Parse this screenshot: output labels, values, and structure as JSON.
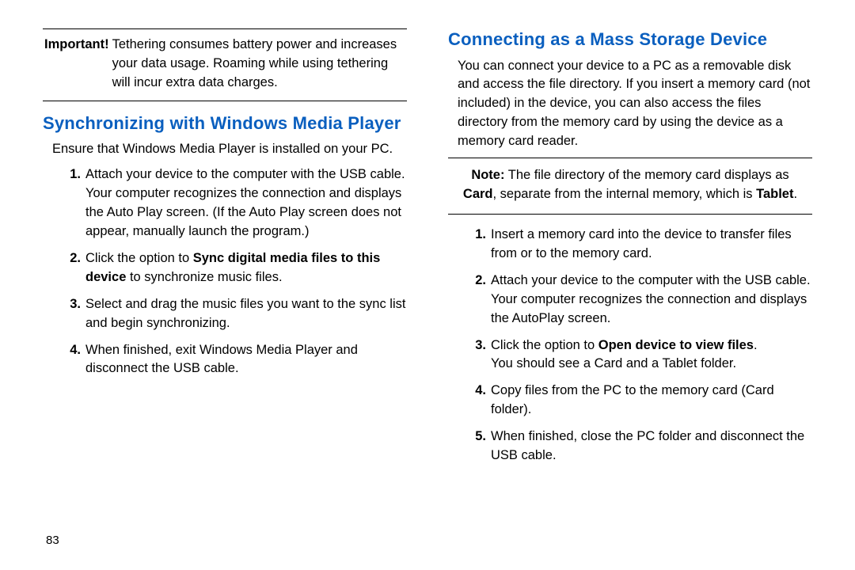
{
  "leftColumn": {
    "important": {
      "label": "Important!",
      "text": "Tethering consumes battery power and increases your data usage. Roaming while using tethering will incur extra data charges."
    },
    "heading": "Synchronizing with Windows Media Player",
    "intro": "Ensure that Windows Media Player is installed on your PC.",
    "steps": {
      "s1": "Attach your device to the computer with the USB cable. Your computer recognizes the connection and displays the Auto Play screen. (If the Auto Play screen does not appear, manually launch the program.)",
      "s2_pre": "Click the option to ",
      "s2_bold": "Sync digital media files to this device",
      "s2_post": " to synchronize music files.",
      "s3": "Select and drag the music files you want to the sync list and begin synchronizing.",
      "s4": "When finished, exit Windows Media Player and disconnect the USB cable."
    }
  },
  "rightColumn": {
    "heading": "Connecting as a Mass Storage Device",
    "intro": "You can connect your device to a PC as a removable disk and access the file directory. If you insert a memory card (not included) in the device, you can also access the files directory from the memory card by using the device as a memory card reader.",
    "note": {
      "label": "Note:",
      "pre": "The file directory of the memory card displays as ",
      "b1": "Card",
      "mid": ", separate from the internal memory, which is ",
      "b2": "Tablet",
      "post": "."
    },
    "steps": {
      "s1": "Insert a memory card into the device to transfer files from or to the memory card.",
      "s2": "Attach your device to the computer with the USB cable. Your computer recognizes the connection and displays the AutoPlay screen.",
      "s3_pre": "Click the option to ",
      "s3_bold": "Open device to view files",
      "s3_post": ".",
      "s3_line2": "You should see a Card and a Tablet folder.",
      "s4": "Copy files from the PC to the memory card (Card folder).",
      "s5": "When finished, close the PC folder and disconnect the USB cable."
    }
  },
  "pageNumber": "83"
}
